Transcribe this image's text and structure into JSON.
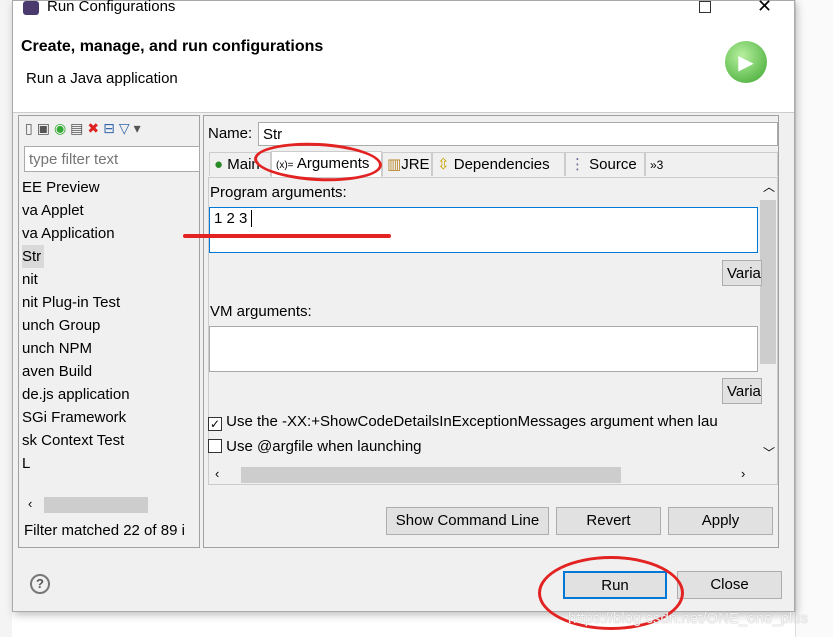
{
  "window": {
    "title": "Run Configurations",
    "header_title": "Create, manage, and run configurations",
    "header_subtitle": "Run a Java application"
  },
  "left": {
    "filter_placeholder": "type filter text",
    "items": [
      "EE Preview",
      "va Applet",
      "va Application",
      "Str",
      "nit",
      "nit Plug-in Test",
      "unch Group",
      "unch NPM",
      "aven Build",
      "de.js application",
      "SGi Framework",
      "sk Context Test",
      "L"
    ],
    "selected": "Str",
    "status": "Filter matched 22 of 89 i"
  },
  "right": {
    "name_label": "Name:",
    "name_value": "Str",
    "tabs": [
      "Main",
      "Arguments",
      "JRE",
      "Dependencies",
      "Source",
      "»3"
    ],
    "active_tab": "Arguments",
    "program_args_label": "Program arguments:",
    "program_args_value": "1 2 3",
    "variables_label": "Varia",
    "vm_args_label": "VM arguments:",
    "vm_args_value": "",
    "check1": {
      "label": "Use the -XX:+ShowCodeDetailsInExceptionMessages argument when lau",
      "checked": true
    },
    "check2": {
      "label": "Use @argfile when launching",
      "checked": false
    },
    "show_cmd": "Show Command Line",
    "revert": "Revert",
    "apply": "Apply"
  },
  "footer": {
    "run": "Run",
    "close": "Close",
    "help_icon": "?"
  },
  "watermark": "https://blog.csdn.net/ONE_one_plus",
  "colors": {
    "annotation": "#e32222",
    "focus": "#0078d7"
  }
}
